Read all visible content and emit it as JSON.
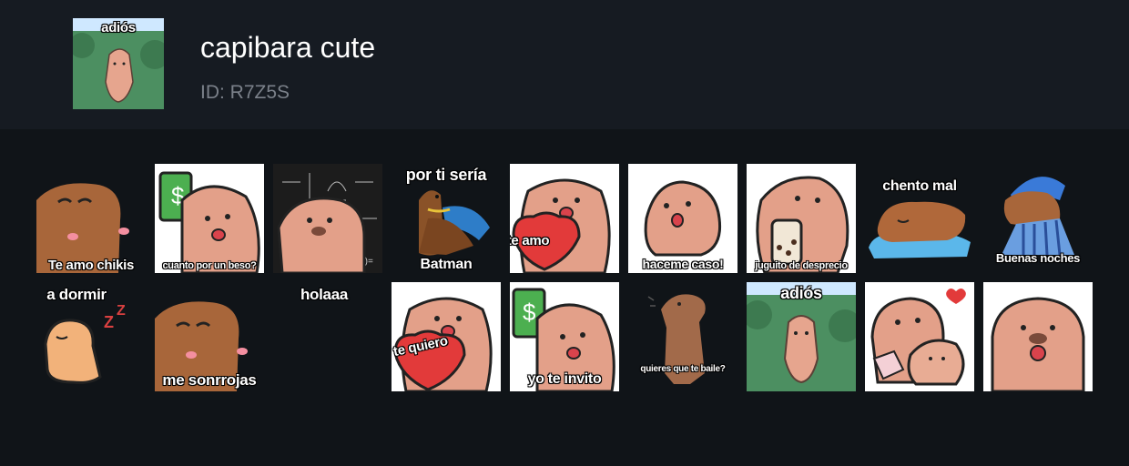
{
  "pack": {
    "title": "capibara cute",
    "id_label": "ID: R7Z5S",
    "cover_caption": "adiós"
  },
  "stickers": [
    {
      "caption": "Te amo chikis",
      "bg": "transparent"
    },
    {
      "caption": "cuanto por un beso?",
      "bg": "#ffffff"
    },
    {
      "caption": "",
      "bg": "#1c1c1c"
    },
    {
      "caption_top": "por ti sería",
      "caption": "Batman",
      "bg": "transparent"
    },
    {
      "caption": "te amo",
      "bg": "#ffffff"
    },
    {
      "caption": "haceme caso!",
      "bg": "#ffffff"
    },
    {
      "caption": "juguito de desprecio",
      "bg": "#ffffff"
    },
    {
      "caption_top": "chento mal",
      "bg": "transparent"
    },
    {
      "caption": "Buenas noches",
      "bg": "transparent"
    },
    {
      "caption_top": "a dormir",
      "bg": "transparent"
    },
    {
      "caption": "me sonrrojas",
      "bg": "transparent"
    },
    {
      "caption_top": "holaaa",
      "bg": "transparent"
    },
    {
      "caption": "te quiero",
      "bg": "#ffffff"
    },
    {
      "caption": "yo te invito",
      "bg": "#ffffff"
    },
    {
      "caption": "quieres que te baile?",
      "bg": "transparent"
    },
    {
      "caption_top": "adiós",
      "bg": "#4c8f61"
    },
    {
      "caption": "",
      "bg": "#ffffff"
    },
    {
      "caption": "",
      "bg": "#ffffff"
    }
  ]
}
